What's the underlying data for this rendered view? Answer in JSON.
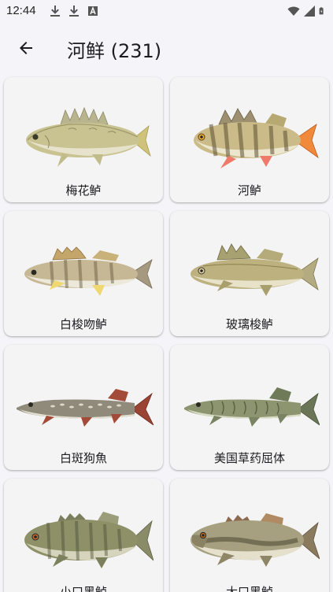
{
  "status_bar": {
    "time": "12:44",
    "left_icons": [
      "download-icon",
      "download-icon",
      "font-a-icon"
    ],
    "right_icons": [
      "wifi-icon",
      "signal-icon",
      "battery-icon"
    ]
  },
  "app_bar": {
    "title": "河鲜 (231)",
    "back_icon": "arrow-left-icon"
  },
  "fish": [
    {
      "name": "梅花鲈"
    },
    {
      "name": "河鲈"
    },
    {
      "name": "白梭吻鲈"
    },
    {
      "name": "玻璃梭鲈"
    },
    {
      "name": "白斑狗魚"
    },
    {
      "name": "美国草药屈体"
    },
    {
      "name": "小口黑鲈"
    },
    {
      "name": "大口黑鲈"
    }
  ],
  "colors": {
    "background": "#f5f4f8",
    "card": "#f4f4f4",
    "text": "#1c1b1f"
  }
}
